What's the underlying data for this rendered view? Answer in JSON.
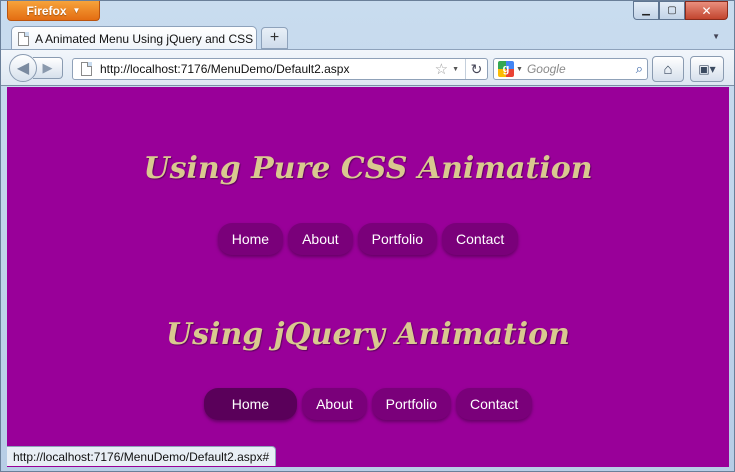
{
  "browser": {
    "app_button": "Firefox",
    "window_controls": {
      "minimize": "▁",
      "maximize": "▢",
      "close": "✕"
    },
    "tab": {
      "title": "A Animated Menu Using jQuery and CSS"
    },
    "new_tab": "+",
    "address": "http://localhost:7176/MenuDemo/Default2.aspx",
    "search": {
      "placeholder": "Google",
      "engine_letter": "g"
    },
    "status_text": "http://localhost:7176/MenuDemo/Default2.aspx#"
  },
  "page": {
    "sections": [
      {
        "heading": "Using Pure CSS Animation",
        "menu": [
          "Home",
          "About",
          "Portfolio",
          "Contact"
        ]
      },
      {
        "heading": "Using jQuery Animation",
        "menu": [
          "Home",
          "About",
          "Portfolio",
          "Contact"
        ],
        "active": "Home"
      }
    ]
  },
  "colors": {
    "page_background": "#990099",
    "heading": "#d9c98f",
    "menu_item": "#7a007a",
    "menu_item_active": "#5a005a",
    "firefox_button": "#e46d12"
  },
  "icons": [
    "page-icon",
    "back-arrow-icon",
    "forward-arrow-icon",
    "star-icon",
    "reload-icon",
    "search-icon",
    "home-icon",
    "addon-bar-icon"
  ]
}
